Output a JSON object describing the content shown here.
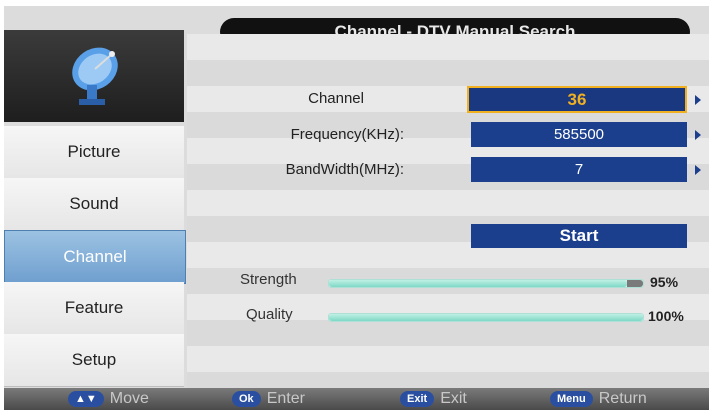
{
  "title": "Channel - DTV Manual Search",
  "sidebar": {
    "icon": "satellite-dish-icon",
    "items": [
      {
        "label": "Picture",
        "active": false
      },
      {
        "label": "Sound",
        "active": false
      },
      {
        "label": "Channel",
        "active": true
      },
      {
        "label": "Feature",
        "active": false
      },
      {
        "label": "Setup",
        "active": false
      }
    ]
  },
  "form": {
    "channel_label": "Channel",
    "channel_value": "36",
    "frequency_label": "Frequency(KHz):",
    "frequency_value": "585500",
    "bandwidth_label": "BandWidth(MHz):",
    "bandwidth_value": "7",
    "start_label": "Start"
  },
  "signal": {
    "strength_label": "Strength",
    "strength_value": "95%",
    "strength_level": 0.95,
    "quality_label": "Quality",
    "quality_value": "100%",
    "quality_level": 1.0
  },
  "bottom_bar": {
    "move_key": "▲▼",
    "move_label": "Move",
    "ok_key": "Ok",
    "ok_label": "Enter",
    "exit_key": "Exit",
    "exit_label": "Exit",
    "menu_key": "Menu",
    "menu_label": "Return"
  },
  "colors": {
    "accent_blue": "#1b3f8c",
    "selection_gold": "#f0b020",
    "active_menu": "#6f9fcf"
  }
}
